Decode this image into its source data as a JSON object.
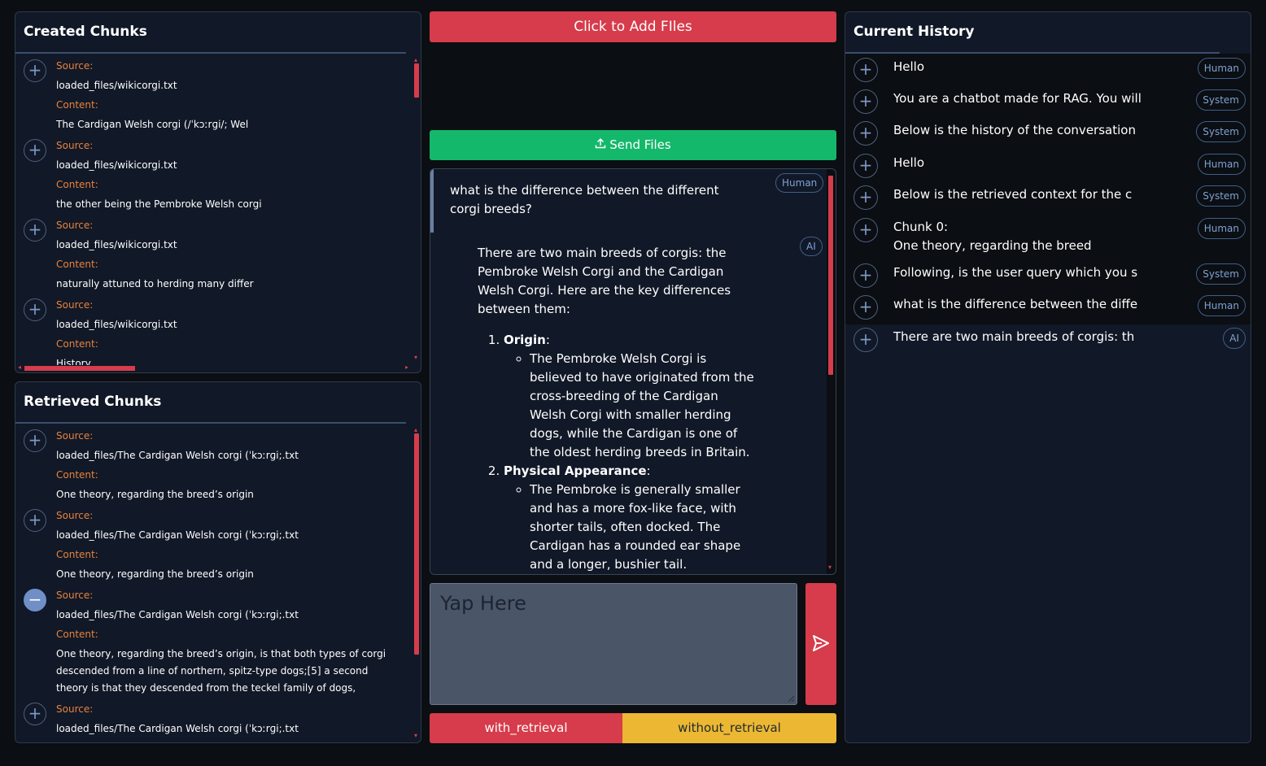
{
  "created_chunks": {
    "title": "Created Chunks",
    "items": [
      {
        "source_label": "Source:",
        "source": "loaded_files/wikicorgi.txt",
        "content_label": "Content:",
        "content": "The Cardigan Welsh corgi (/ˈkɔːrɡi/; Wel"
      },
      {
        "source_label": "Source:",
        "source": "loaded_files/wikicorgi.txt",
        "content_label": "Content:",
        "content": "the other being the Pembroke Welsh corgi"
      },
      {
        "source_label": "Source:",
        "source": "loaded_files/wikicorgi.txt",
        "content_label": "Content:",
        "content": "naturally attuned to herding many differ"
      },
      {
        "source_label": "Source:",
        "source": "loaded_files/wikicorgi.txt",
        "content_label": "Content:",
        "content": "History"
      }
    ]
  },
  "retrieved_chunks": {
    "title": "Retrieved Chunks",
    "items": [
      {
        "source_label": "Source:",
        "source": "loaded_files/The Cardigan Welsh corgi (ˈkɔːrɡi;.txt",
        "content_label": "Content:",
        "content": "One theory, regarding the breed’s origin"
      },
      {
        "source_label": "Source:",
        "source": "loaded_files/The Cardigan Welsh corgi (ˈkɔːrɡi;.txt",
        "content_label": "Content:",
        "content": "One theory, regarding the breed’s origin"
      },
      {
        "source_label": "Source:",
        "source": "loaded_files/The Cardigan Welsh corgi (ˈkɔːrɡi;.txt",
        "content_label": "Content:",
        "content": "One theory, regarding the breed’s origin, is that both types of corgi descended from a line of northern, spitz-type dogs;[5] a second theory is that they descended from the teckel family of dogs,"
      },
      {
        "source_label": "Source:",
        "source": "loaded_files/The Cardigan Welsh corgi (ˈkɔːrɡi;.txt"
      }
    ]
  },
  "upload": {
    "add_files": "Click to Add FIles",
    "send_files": "Send Files"
  },
  "chat": {
    "human_badge": "Human",
    "human_text": "what is the difference between the different corgi breeds?",
    "ai_badge": "AI",
    "ai_intro": "There are two main breeds of corgis: the Pembroke Welsh Corgi and the Cardigan Welsh Corgi. Here are the key differences between them:",
    "points": [
      {
        "heading": "Origin",
        "sep": ":",
        "bullet": "The Pembroke Welsh Corgi is believed to have originated from the cross-breeding of the Cardigan Welsh Corgi with smaller herding dogs, while the Cardigan is one of the oldest herding breeds in Britain."
      },
      {
        "heading": "Physical Appearance",
        "sep": ":",
        "bullet": "The Pembroke is generally smaller and has a more fox-like face, with shorter tails, often docked. The Cardigan has a rounded ear shape and a longer, bushier tail."
      }
    ]
  },
  "input": {
    "placeholder": "Yap Here"
  },
  "toggles": {
    "with": "with_retrieval",
    "without": "without_retrieval"
  },
  "history": {
    "title": "Current History",
    "items": [
      {
        "text": "Hello",
        "role": "Human"
      },
      {
        "text": "You are a chatbot made for RAG. You will",
        "role": "System"
      },
      {
        "text": "Below is the history of the conversation",
        "role": "System"
      },
      {
        "text": "Hello",
        "role": "Human"
      },
      {
        "text": "Below is the retrieved context for the c",
        "role": "System"
      },
      {
        "text": "Chunk 0:",
        "text2": "One theory, regarding the breed",
        "role": "Human"
      },
      {
        "text": "Following, is the user query which you s",
        "role": "System"
      },
      {
        "text": "what is the difference between the diffe",
        "role": "Human"
      },
      {
        "text": "There are two main breeds of corgis: th",
        "role": "AI"
      }
    ]
  },
  "colors": {
    "accent_red": "#d63c4b",
    "green": "#14b86a",
    "yellow": "#ecb732",
    "orange_label": "#e8823c",
    "panel_bg": "#111827"
  },
  "icons": {
    "add": "plus-icon",
    "remove": "minus-icon",
    "upload": "upload-icon",
    "send": "send-icon"
  }
}
